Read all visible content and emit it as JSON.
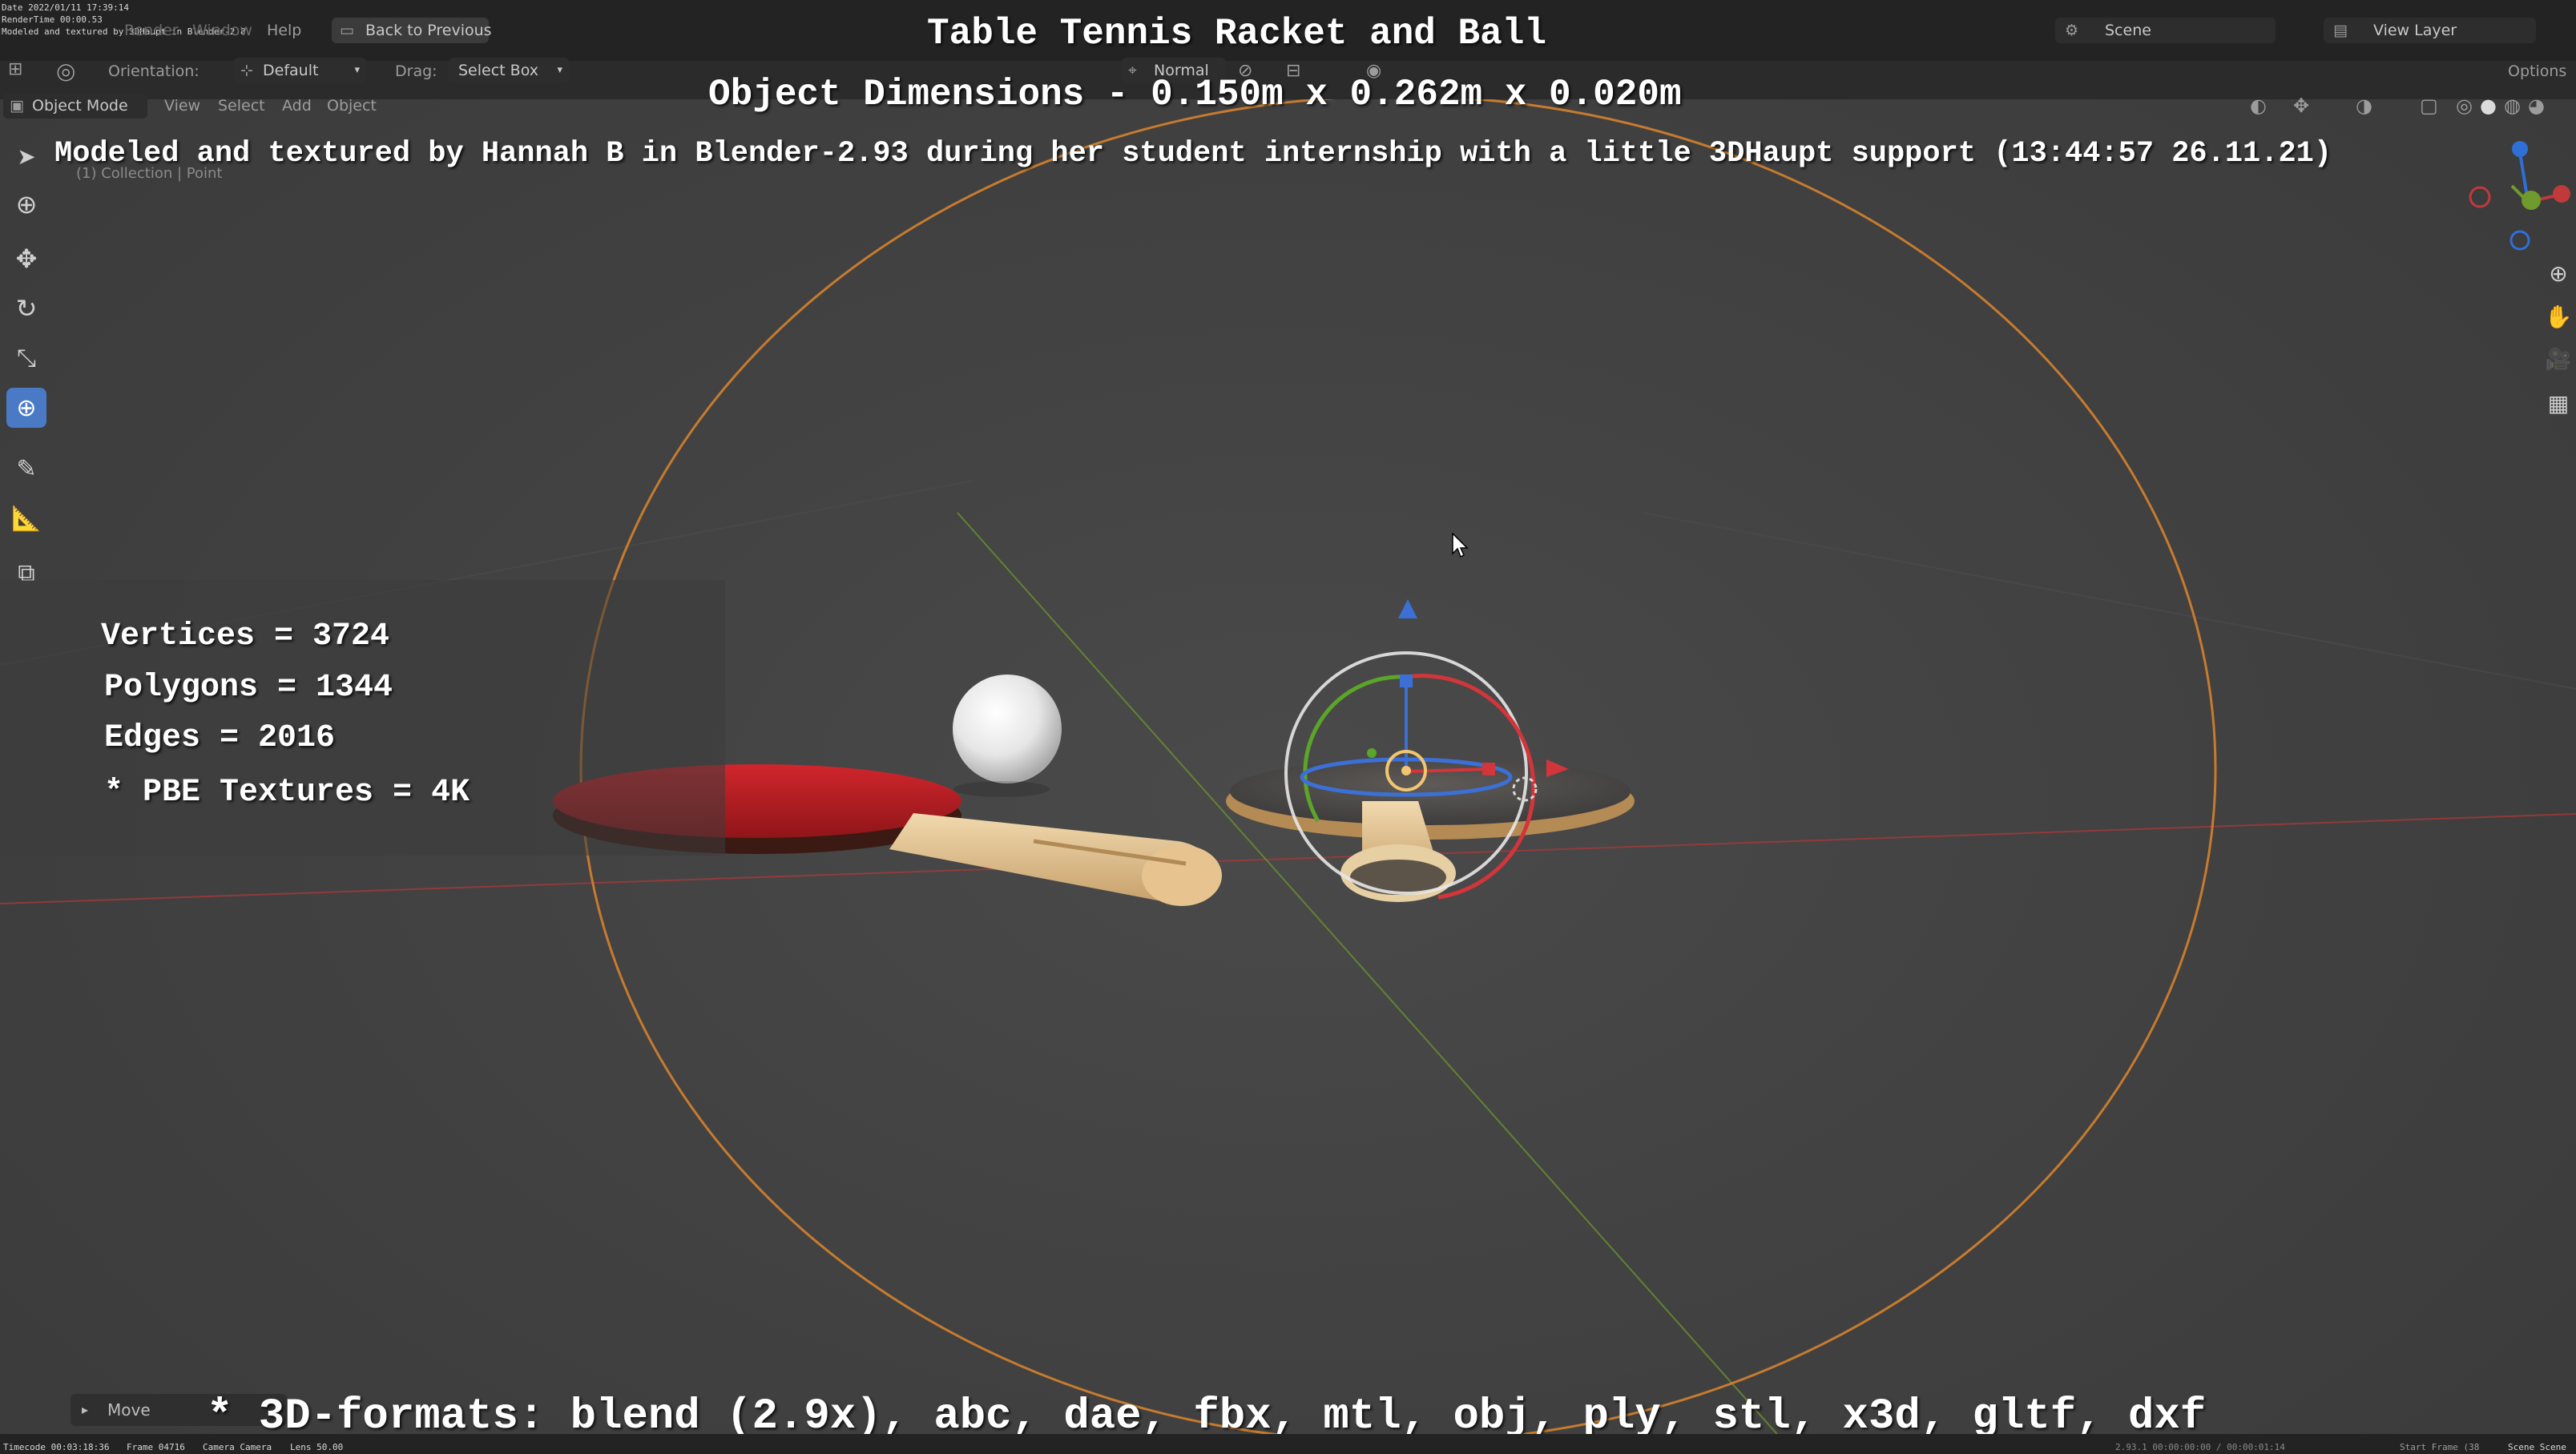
{
  "overlay": {
    "title": "Table Tennis Racket and Ball",
    "dimensions": "Object Dimensions -  0.150m x 0.262m x 0.020m",
    "credit": "Modeled and textured by Hannah B in Blender-2.93 during her student internship with a little 3DHaupt support (13:44:57 26.11.21)",
    "stats": {
      "vertices": "Vertices = 3724",
      "polygons": "Polygons = 1344",
      "edges": "Edges = 2016",
      "textures": "* PBE Textures = 4K"
    },
    "formats": "* 3D-formats: blend (2.9x), abc, dae, fbx, mtl, obj, ply, stl, x3d, gltf, dxf"
  },
  "render_stamp": {
    "date": "Date 2022/01/11 17:39:14",
    "rendertime": "RenderTime 00:00.53",
    "note": "Modeled and textured by 3DHaupt in Blender-2.8"
  },
  "topbar": {
    "menu_render": "Render",
    "menu_window": "Window",
    "menu_help": "Help",
    "back_button": "Back to Previous",
    "scene_label": "Scene",
    "view_layer_label": "View Layer"
  },
  "tool_header": {
    "orientation_label": "Orientation:",
    "orientation_value": "Default",
    "drag_label": "Drag:",
    "drag_value": "Select Box",
    "pivot_value": "Normal",
    "options_label": "Options"
  },
  "viewport_header": {
    "mode": "Object Mode",
    "menu_view": "View",
    "menu_select": "Select",
    "menu_add": "Add",
    "menu_object": "Object",
    "collection_info": "(1) Collection | Point"
  },
  "last_operator": {
    "label": "Move"
  },
  "status_bar": {
    "timecode": "Timecode 00:03:18:36",
    "frame": "Frame 04716",
    "camera": "Camera Camera",
    "lens": "Lens 50.00",
    "version_time": "2.93.1  00:00:00:00 / 00:00:01:14",
    "start_frame": "Start Frame (38",
    "scene_right": "Scene Scene"
  },
  "colors": {
    "accent_blue": "#4a7ac6",
    "paddle_red": "#b51e22",
    "light_orange": "#e08a2c",
    "axis_x": "#c0393b",
    "axis_y": "#6f9a2d",
    "axis_z": "#2f6fd6"
  }
}
